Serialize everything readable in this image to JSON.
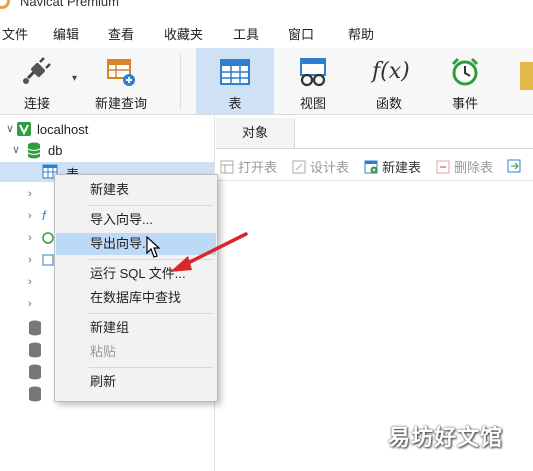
{
  "window": {
    "title": "Navicat Premium"
  },
  "menubar": {
    "items": [
      "文件",
      "编辑",
      "查看",
      "收藏夹",
      "工具",
      "窗口",
      "帮助"
    ]
  },
  "toolbar": {
    "connect": "连接",
    "new_query": "新建查询",
    "table": "表",
    "view": "视图",
    "function": "函数",
    "event": "事件",
    "function_glyph": "f(x)"
  },
  "tree": {
    "connection": "localhost",
    "database": "db",
    "tables_node": "表"
  },
  "tabs": {
    "objects": "对象"
  },
  "object_toolbar": {
    "open_table": "打开表",
    "design_table": "设计表",
    "new_table": "新建表",
    "delete_table": "删除表"
  },
  "context_menu": {
    "items": [
      {
        "label": "新建表",
        "state": "normal"
      },
      {
        "label": "导入向导...",
        "state": "normal"
      },
      {
        "label": "导出向导...",
        "state": "highlighted"
      },
      {
        "label": "运行 SQL 文件...",
        "state": "normal"
      },
      {
        "label": "在数据库中查找",
        "state": "normal"
      },
      {
        "label": "新建组",
        "state": "normal"
      },
      {
        "label": "粘贴",
        "state": "disabled"
      },
      {
        "label": "刷新",
        "state": "normal"
      }
    ]
  },
  "watermark": "易坊好文馆",
  "colors": {
    "active_tab": "#cfe1f5",
    "menu_highlight": "#bcd9f5",
    "arrow": "#d9262b",
    "db_green": "#2e9e3e"
  }
}
